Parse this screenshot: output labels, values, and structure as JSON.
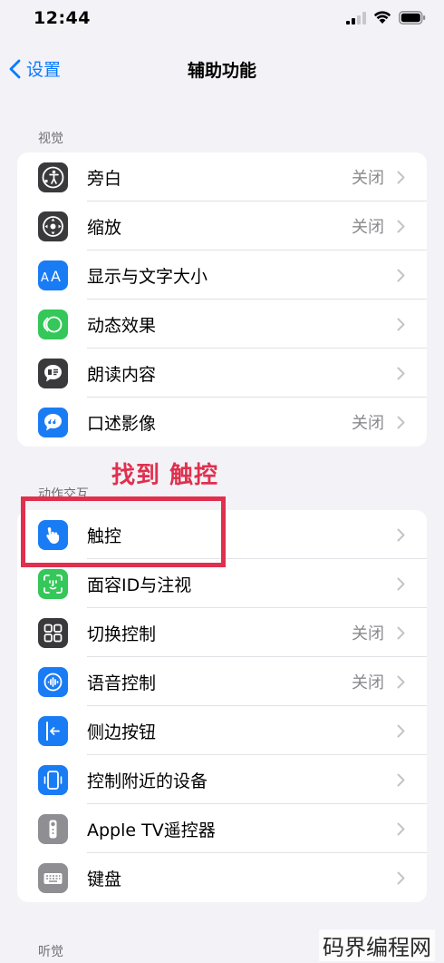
{
  "status_bar": {
    "time": "12:44"
  },
  "nav": {
    "back_label": "设置",
    "title": "辅助功能"
  },
  "sections": [
    {
      "header": "视觉",
      "items": [
        {
          "label": "旁白",
          "value": "关闭",
          "icon": "voiceover-icon",
          "color": "#3a3a3c"
        },
        {
          "label": "缩放",
          "value": "关闭",
          "icon": "zoom-icon",
          "color": "#3a3a3c"
        },
        {
          "label": "显示与文字大小",
          "value": "",
          "icon": "text-size-icon",
          "color": "#1a7cf5"
        },
        {
          "label": "动态效果",
          "value": "",
          "icon": "motion-icon",
          "color": "#34c759"
        },
        {
          "label": "朗读内容",
          "value": "",
          "icon": "spoken-content-icon",
          "color": "#3a3a3c"
        },
        {
          "label": "口述影像",
          "value": "关闭",
          "icon": "audio-description-icon",
          "color": "#1a7cf5"
        }
      ]
    },
    {
      "header": "动作交互",
      "items": [
        {
          "label": "触控",
          "value": "",
          "icon": "touch-icon",
          "color": "#1a7cf5"
        },
        {
          "label": "面容ID与注视",
          "value": "",
          "icon": "face-id-icon",
          "color": "#34c759"
        },
        {
          "label": "切换控制",
          "value": "关闭",
          "icon": "switch-control-icon",
          "color": "#3a3a3c"
        },
        {
          "label": "语音控制",
          "value": "关闭",
          "icon": "voice-control-icon",
          "color": "#1a7cf5"
        },
        {
          "label": "侧边按钮",
          "value": "",
          "icon": "side-button-icon",
          "color": "#1a7cf5"
        },
        {
          "label": "控制附近的设备",
          "value": "",
          "icon": "nearby-devices-icon",
          "color": "#1a7cf5"
        },
        {
          "label": "Apple TV遥控器",
          "value": "",
          "icon": "apple-tv-remote-icon",
          "color": "#8e8e93"
        },
        {
          "label": "键盘",
          "value": "",
          "icon": "keyboard-icon",
          "color": "#8e8e93"
        }
      ]
    },
    {
      "header": "听觉",
      "items": []
    }
  ],
  "annotation": {
    "text": "找到 触控"
  },
  "watermark": "码界编程网",
  "colors": {
    "accent": "#0a7aff",
    "annotation": "#e0304e",
    "background": "#f2f2f7"
  }
}
